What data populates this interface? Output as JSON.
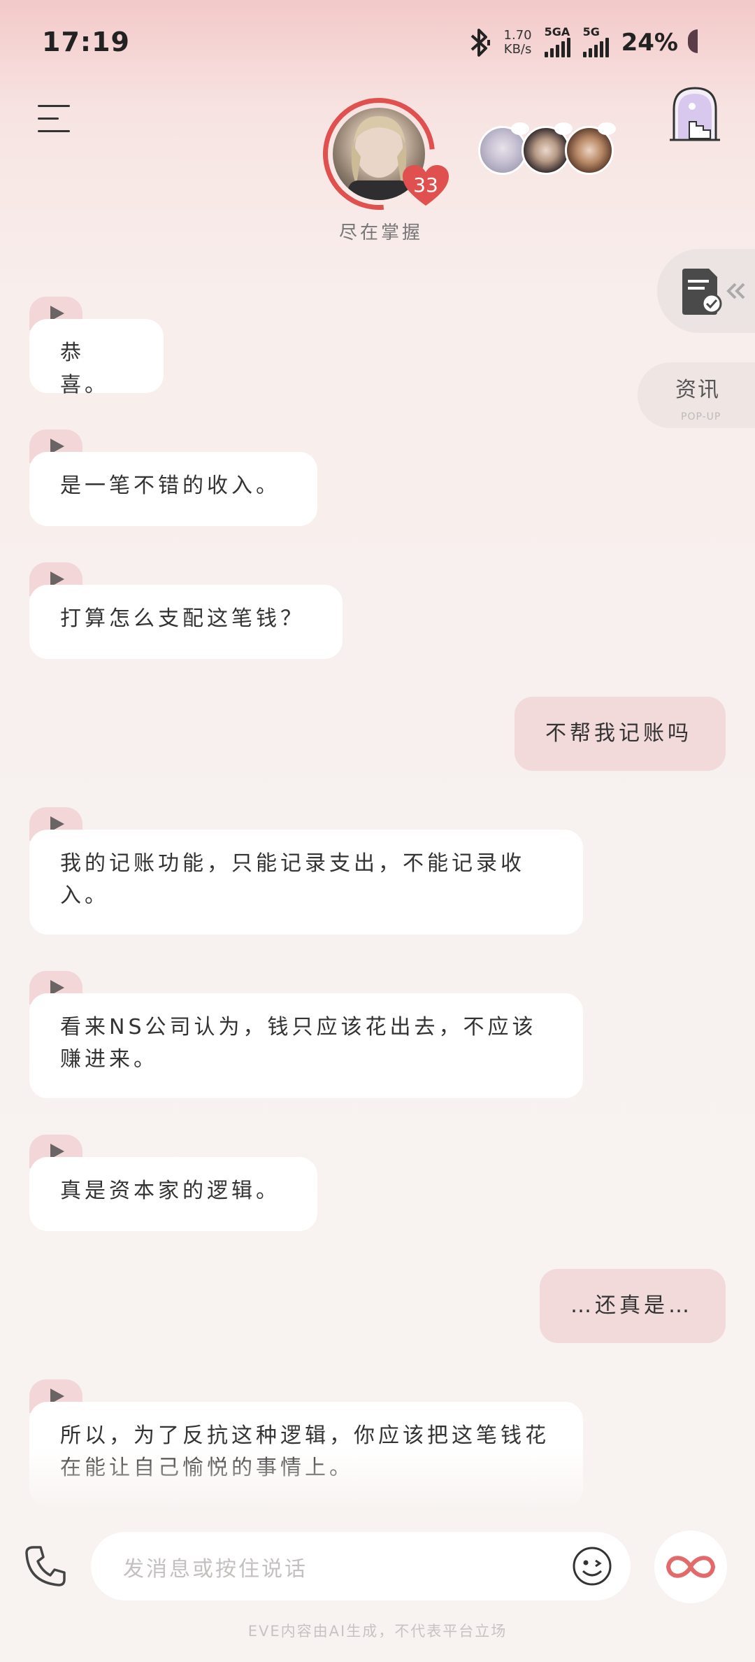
{
  "status_bar": {
    "time": "17:19",
    "net_speed_value": "1.70",
    "net_speed_unit": "KB/s",
    "sim1_label": "5GA",
    "sim2_label": "5G",
    "battery": "24%"
  },
  "header": {
    "character_name": "尽在掌握",
    "affection": "33",
    "accent_color": "#e0504f"
  },
  "side_tabs": {
    "news_title": "资讯",
    "news_subtitle": "POP-UP"
  },
  "messages": [
    {
      "from": "ai",
      "text": "恭喜。"
    },
    {
      "from": "ai",
      "text": "是一笔不错的收入。"
    },
    {
      "from": "ai",
      "text": "打算怎么支配这笔钱？"
    },
    {
      "from": "me",
      "text": "不帮我记账吗"
    },
    {
      "from": "ai",
      "text": "我的记账功能，只能记录支出，不能记录收入。"
    },
    {
      "from": "ai",
      "text": "看来NS公司认为，钱只应该花出去，不应该赚进来。"
    },
    {
      "from": "ai",
      "text": "真是资本家的逻辑。"
    },
    {
      "from": "me",
      "text": "…还真是…"
    },
    {
      "from": "ai",
      "text": "所以，为了反抗这种逻辑，你应该把这笔钱花在能让自己愉悦的事情上。"
    }
  ],
  "input": {
    "placeholder": "发消息或按住说话"
  },
  "footer": {
    "disclaimer": "EVE内容由AI生成，不代表平台立场"
  },
  "icons": [
    "bluetooth-icon",
    "menu-icon",
    "gate-icon",
    "document-check-icon",
    "play-icon",
    "phone-icon",
    "emoji-icon",
    "infinity-icon"
  ]
}
